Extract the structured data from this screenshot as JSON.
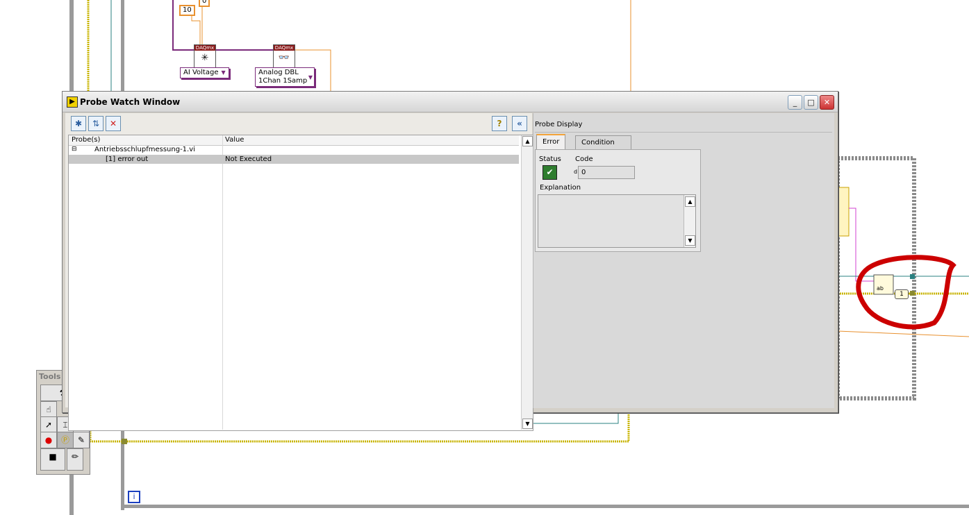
{
  "diagram": {
    "const_10": "10",
    "const_0": "0",
    "ai_voltage_label": "AI Voltage",
    "analog_dbl_line1": "Analog DBL",
    "analog_dbl_line2": "1Chan 1Samp",
    "daqmx_label": "DAQmx",
    "loop_iteration_label": "i",
    "index_constant": "1"
  },
  "probe_window": {
    "title": "Probe Watch Window",
    "toolbar": {
      "new_probe_icon": "new-probe-icon",
      "arrange_icon": "arrange-icon",
      "delete_icon": "delete-icon",
      "help_icon": "help-icon",
      "collapse_icon": "collapse-icon"
    },
    "table": {
      "columns": [
        "Probe(s)",
        "Value"
      ],
      "rows": [
        {
          "probe": "Antriebsschlupfmessung-1.vi",
          "value": ""
        },
        {
          "probe": "[1] error out",
          "value": "Not Executed"
        }
      ]
    },
    "display": {
      "title": "Probe Display",
      "tabs": [
        "Error",
        "Condition"
      ],
      "status_label": "Status",
      "code_label": "Code",
      "code_prefix": "d",
      "code_value": "0",
      "explanation_label": "Explanation"
    }
  },
  "tools_palette": {
    "title": "Tools"
  },
  "colors": {
    "wire_orange": "#e8902e",
    "wire_purple": "#7a2a7a",
    "wire_teal": "#2a8080",
    "error_wire_yellow": "#d8c000",
    "highlight_red": "#cc0000",
    "status_ok_green": "#2f7d2f"
  }
}
